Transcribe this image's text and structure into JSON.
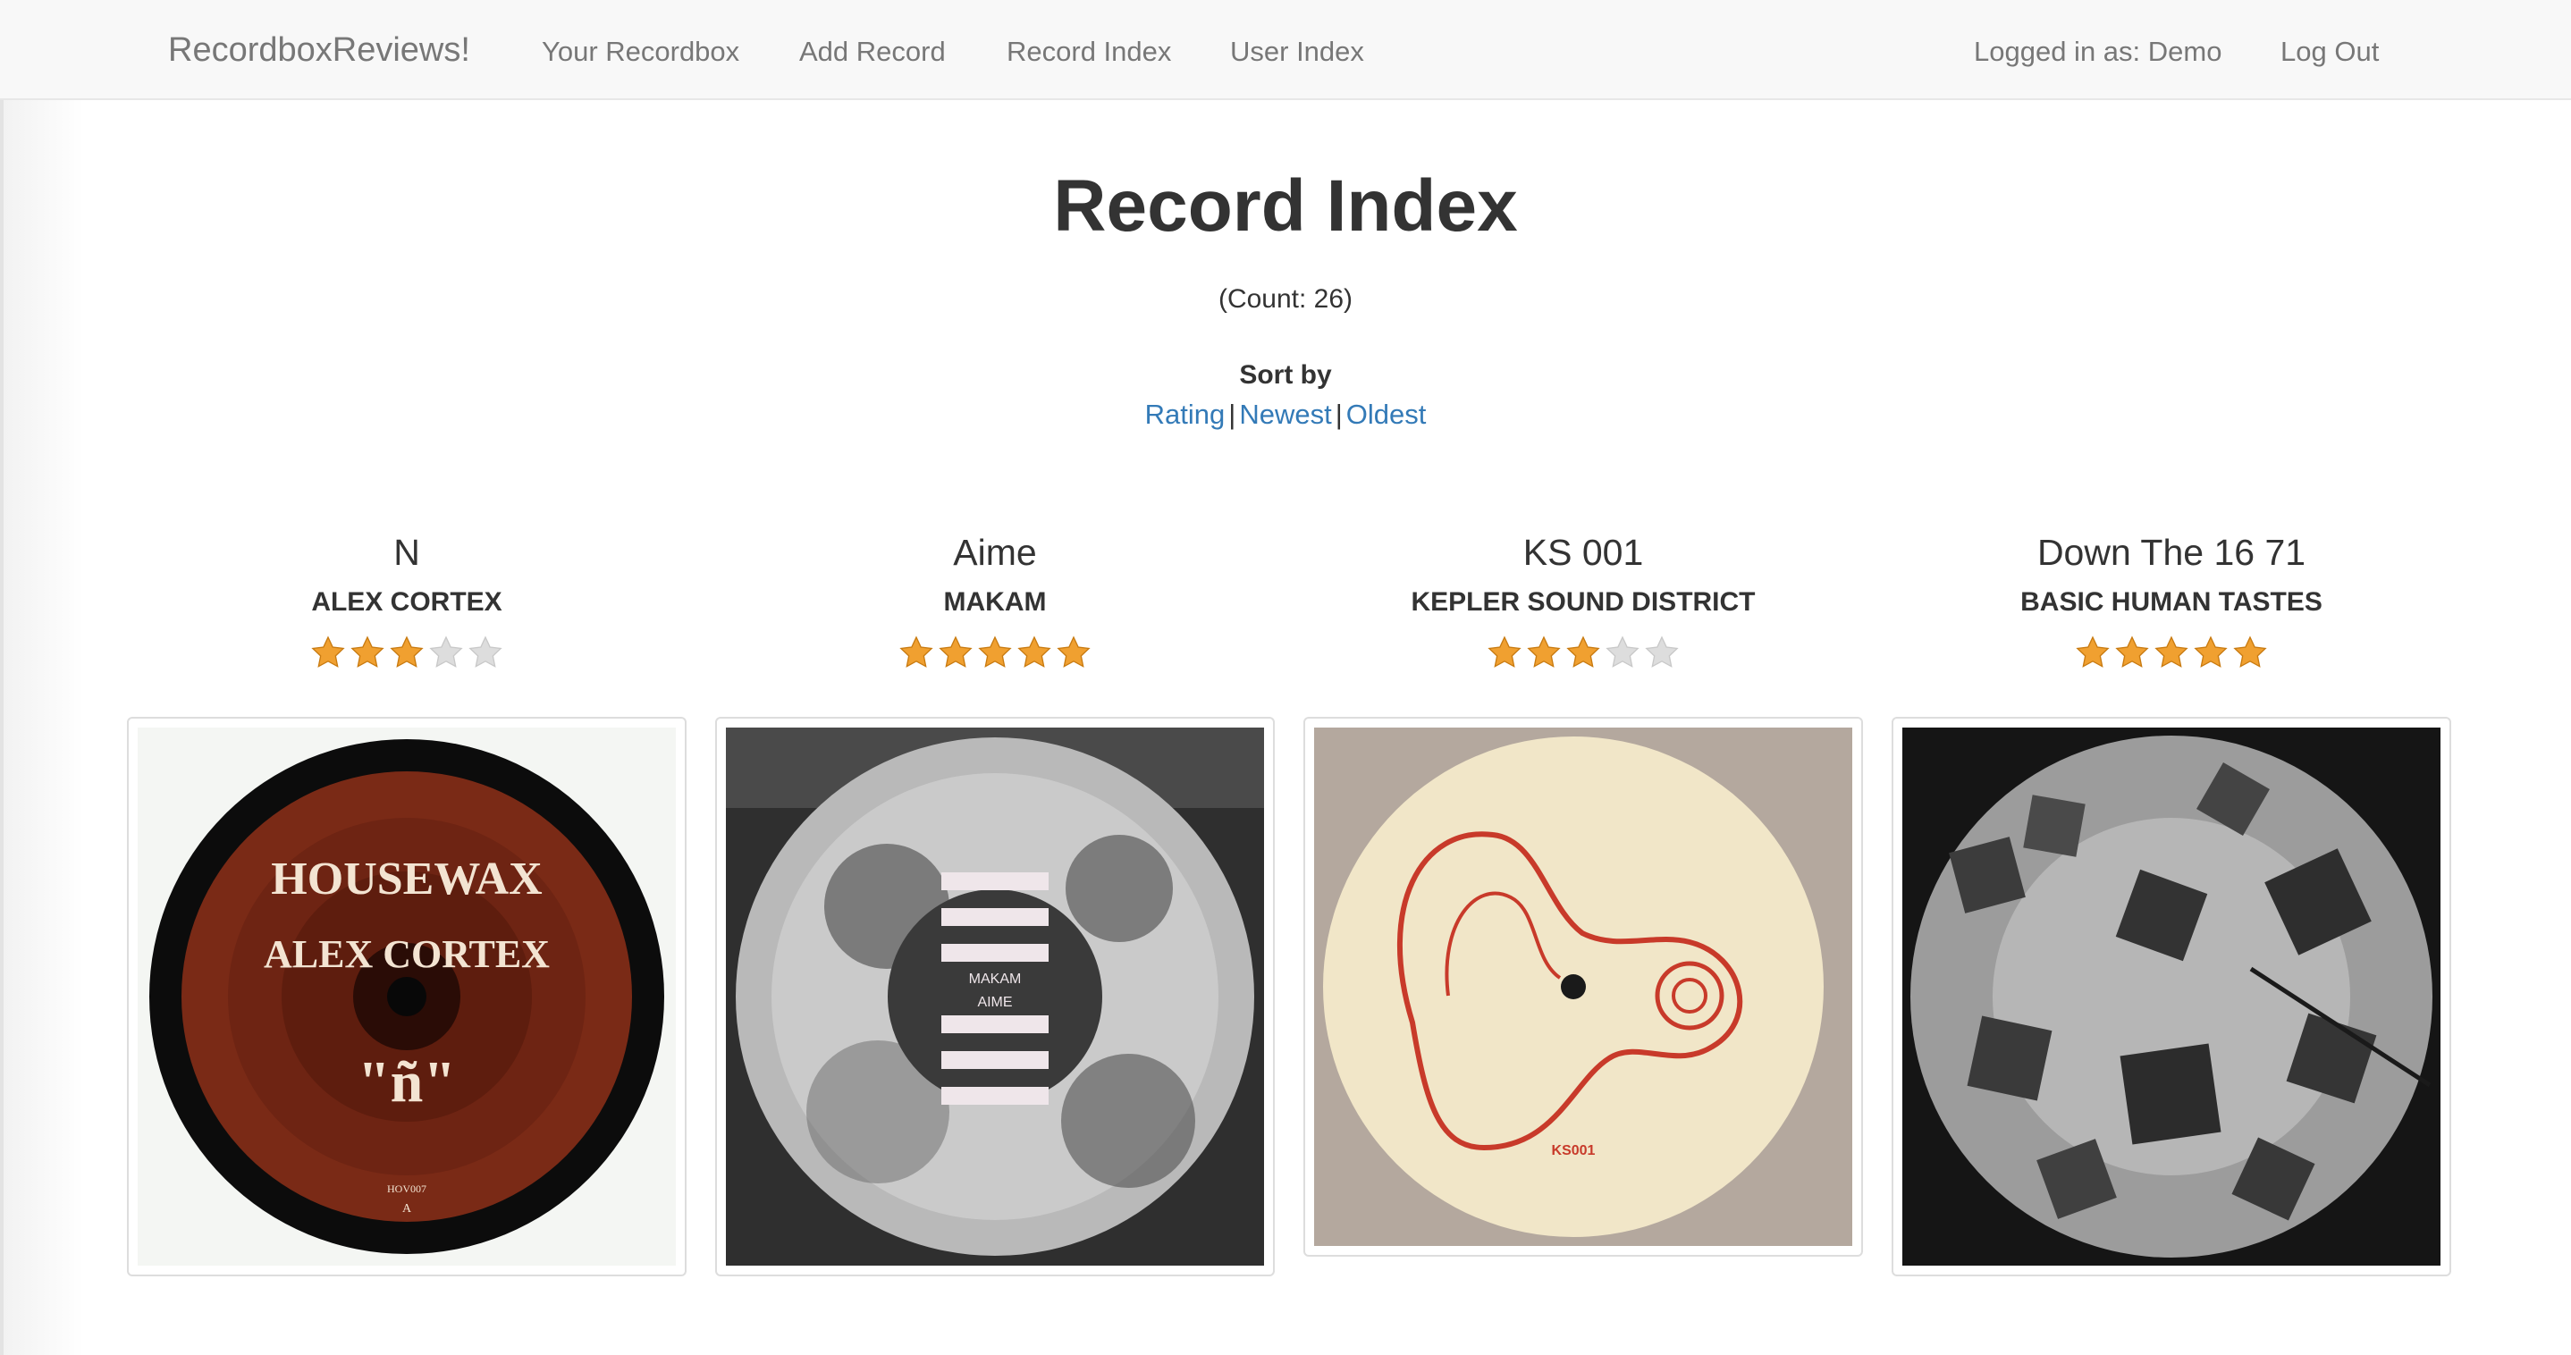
{
  "navbar": {
    "brand": "RecordboxReviews!",
    "links": [
      "Your Recordbox",
      "Add Record",
      "Record Index",
      "User Index"
    ],
    "logged_in": "Logged in as: Demo",
    "logout": "Log Out"
  },
  "page": {
    "title": "Record Index",
    "count": "(Count: 26)",
    "sort_label": "Sort by",
    "sort_options": [
      "Rating",
      "Newest",
      "Oldest"
    ],
    "sort_separator": "|"
  },
  "records": [
    {
      "title": "N",
      "artist": "ALEX CORTEX",
      "rating": 3,
      "max_rating": 5,
      "cover": {
        "style": "red-label-vinyl",
        "label_line1": "HOUSEWAX",
        "label_line2": "ALEX CORTEX",
        "label_line3": "\"ñ\"",
        "catalog": "HOV007",
        "side": "A"
      }
    },
    {
      "title": "Aime",
      "artist": "MAKAM",
      "rating": 5,
      "max_rating": 5,
      "cover": {
        "style": "grey-abstract",
        "label_line1": "MAKAM",
        "label_line2": "AIME"
      }
    },
    {
      "title": "KS 001",
      "artist": "KEPLER SOUND DISTRICT",
      "rating": 3,
      "max_rating": 5,
      "cover": {
        "style": "ear-drawing",
        "catalog": "KS001"
      }
    },
    {
      "title": "Down The 16 71",
      "artist": "BASIC HUMAN TASTES",
      "rating": 5,
      "max_rating": 5,
      "cover": {
        "style": "dark-cubes"
      }
    }
  ],
  "colors": {
    "link": "#337ab7",
    "star_filled": "#f0a030",
    "star_empty": "#dddddd",
    "navbar_bg": "#f8f8f8"
  }
}
